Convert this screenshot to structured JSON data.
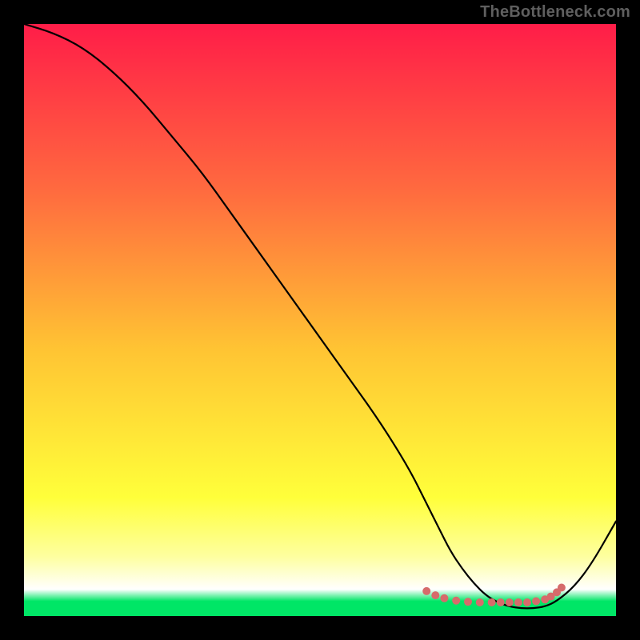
{
  "watermark": {
    "text": "TheBottleneck.com"
  },
  "chart_data": {
    "type": "line",
    "title": "",
    "xlabel": "",
    "ylabel": "",
    "xlim": [
      0,
      100
    ],
    "ylim": [
      0,
      100
    ],
    "grid": false,
    "legend": false,
    "background_gradient": [
      {
        "offset": 0.0,
        "color": "#ff1d48"
      },
      {
        "offset": 0.28,
        "color": "#ff6a3f"
      },
      {
        "offset": 0.55,
        "color": "#ffc433"
      },
      {
        "offset": 0.8,
        "color": "#ffff3a"
      },
      {
        "offset": 0.9,
        "color": "#feffa0"
      },
      {
        "offset": 0.955,
        "color": "#ffffff"
      },
      {
        "offset": 0.975,
        "color": "#00e666"
      },
      {
        "offset": 1.0,
        "color": "#00e666"
      }
    ],
    "series": [
      {
        "name": "bottleneck-curve",
        "x": [
          0,
          5,
          10,
          15,
          20,
          25,
          30,
          35,
          40,
          45,
          50,
          55,
          60,
          65,
          68,
          70,
          72,
          74,
          76,
          78,
          80,
          82,
          84,
          86,
          88,
          90,
          93,
          96,
          100
        ],
        "y": [
          100,
          98.5,
          96,
          92,
          87,
          81,
          75,
          68,
          61,
          54,
          47,
          40,
          33,
          25,
          19,
          15,
          11,
          8,
          5.5,
          3.5,
          2.3,
          1.6,
          1.3,
          1.3,
          1.6,
          2.5,
          5,
          9,
          16
        ]
      }
    ],
    "optimal_marker": {
      "name": "optimal-range-dots",
      "color": "#d66b6b",
      "x": [
        68,
        69.5,
        71,
        73,
        75,
        77,
        79,
        80.5,
        82,
        83.5,
        85,
        86.5,
        88,
        89,
        90,
        90.8
      ],
      "y": [
        4.2,
        3.5,
        3.0,
        2.6,
        2.4,
        2.3,
        2.3,
        2.3,
        2.3,
        2.3,
        2.3,
        2.5,
        2.8,
        3.3,
        4.0,
        4.8
      ]
    }
  }
}
